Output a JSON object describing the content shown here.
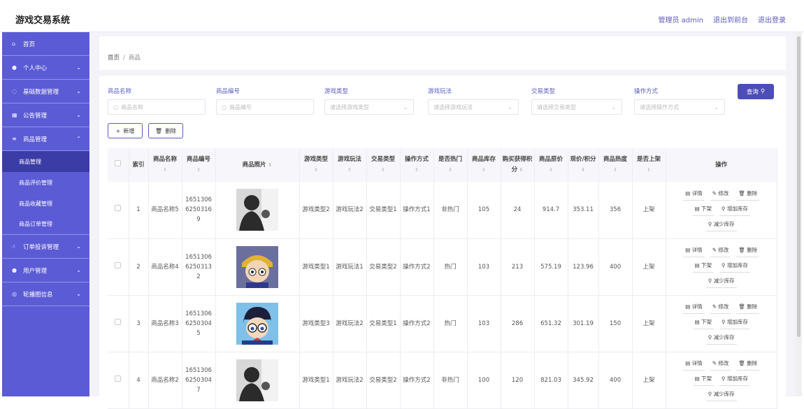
{
  "app": {
    "title": "游戏交易系统"
  },
  "top": {
    "admin": "管理员 admin",
    "to_front": "退出到前台",
    "logout": "退出登录"
  },
  "sidebar": {
    "items": [
      {
        "label": "首页",
        "icon": "home-icon"
      },
      {
        "label": "个人中心",
        "icon": "user-icon"
      },
      {
        "label": "基础数据管理",
        "icon": "bulb-icon"
      },
      {
        "label": "公告管理",
        "icon": "grid-icon"
      },
      {
        "label": "商品管理",
        "icon": "list-icon"
      }
    ],
    "subitems": [
      {
        "label": "商品管理",
        "active": true
      },
      {
        "label": "商品评价管理"
      },
      {
        "label": "商品收藏管理"
      },
      {
        "label": "商品订单管理"
      }
    ],
    "more": [
      {
        "label": "订单投诉管理",
        "icon": "thumb-icon"
      },
      {
        "label": "用户管理",
        "icon": "user-icon"
      },
      {
        "label": "轮播图信息",
        "icon": "circle-icon"
      }
    ]
  },
  "breadcrumb": {
    "home": "首页",
    "sep": "/",
    "current": "商品"
  },
  "filters": {
    "name_label": "商品名称",
    "name_ph": "商品名称",
    "code_label": "商品编号",
    "code_ph": "商品编号",
    "gtype_label": "游戏类型",
    "gtype_ph": "请选择游戏类型",
    "gplay_label": "游戏玩法",
    "gplay_ph": "请选择游戏玩法",
    "ttype_label": "交易类型",
    "ttype_ph": "请选择交易类型",
    "opway_label": "操作方式",
    "opway_ph": "请选择操作方式",
    "query": "查询"
  },
  "actions": {
    "add": "新增",
    "delete": "删除"
  },
  "table": {
    "headers": [
      "索引",
      "商品名称",
      "商品编号",
      "商品照片",
      "游戏类型",
      "游戏玩法",
      "交易类型",
      "操作方式",
      "是否热门",
      "商品库存",
      "购买获得积分",
      "商品原价",
      "现价/积分",
      "商品热度",
      "是否上架",
      "操作"
    ],
    "ops": {
      "detail": "详情",
      "edit": "修改",
      "del": "删除",
      "off": "下架",
      "inc": "增加库存",
      "dec": "减少库存"
    },
    "rows": [
      {
        "idx": "1",
        "name": "商品名称5",
        "code": "16513066250316 9",
        "gtype": "游戏类型2",
        "gplay": "游戏玩法2",
        "ttype": "交易类型1",
        "opway": "操作方式1",
        "hot": "非热门",
        "stock": "105",
        "points": "24",
        "orig": "914.7",
        "now": "353.11",
        "heat": "356",
        "shelf": "上架"
      },
      {
        "idx": "2",
        "name": "商品名称4",
        "code": "16513066250313 2",
        "gtype": "游戏类型1",
        "gplay": "游戏玩法1",
        "ttype": "交易类型2",
        "opway": "操作方式2",
        "hot": "热门",
        "stock": "103",
        "points": "213",
        "orig": "575.19",
        "now": "123.96",
        "heat": "400",
        "shelf": "上架"
      },
      {
        "idx": "3",
        "name": "商品名称3",
        "code": "16513066250304 5",
        "gtype": "游戏类型3",
        "gplay": "游戏玩法2",
        "ttype": "交易类型1",
        "opway": "操作方式2",
        "hot": "热门",
        "stock": "103",
        "points": "286",
        "orig": "651.32",
        "now": "301.19",
        "heat": "150",
        "shelf": "上架"
      },
      {
        "idx": "4",
        "name": "商品名称2",
        "code": "16513066250304 7",
        "gtype": "游戏类型1",
        "gplay": "游戏玩法2",
        "ttype": "交易类型2",
        "opway": "操作方式2",
        "hot": "非热门",
        "stock": "100",
        "points": "120",
        "orig": "821.03",
        "now": "345.92",
        "heat": "400",
        "shelf": "上架"
      }
    ]
  }
}
